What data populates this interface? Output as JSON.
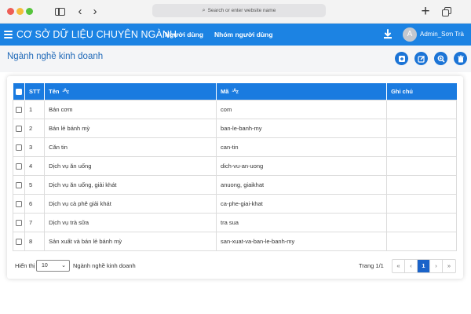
{
  "browser": {
    "address_placeholder": "Search or enter website name"
  },
  "header": {
    "app_title": "CƠ SỞ DỮ LIỆU CHUYÊN NGÀNH",
    "nav": [
      "Người dùng",
      "Nhóm người dùng"
    ],
    "avatar_letter": "A",
    "user_name": "Admin_Sơn Trà"
  },
  "page": {
    "title": "Ngành nghề kinh doanh"
  },
  "table": {
    "columns": [
      "STT",
      "Tên",
      "Mã",
      "Ghi chú"
    ],
    "rows": [
      {
        "stt": "1",
        "ten": "Bán cơm",
        "ma": "com",
        "note": ""
      },
      {
        "stt": "2",
        "ten": "Bán lẻ bánh mỳ",
        "ma": "ban-le-banh-my",
        "note": ""
      },
      {
        "stt": "3",
        "ten": "Căn tin",
        "ma": "can-tin",
        "note": ""
      },
      {
        "stt": "4",
        "ten": "Dịch vụ ăn uống",
        "ma": "dich-vu-an-uong",
        "note": ""
      },
      {
        "stt": "5",
        "ten": "Dịch vụ ăn uống, giải khát",
        "ma": "anuong, giaikhat",
        "note": ""
      },
      {
        "stt": "6",
        "ten": "Dịch vụ cà phê giải khát",
        "ma": "ca-phe-giai-khat",
        "note": ""
      },
      {
        "stt": "7",
        "ten": "Dịch vụ trà sữa",
        "ma": "tra sua",
        "note": ""
      },
      {
        "stt": "8",
        "ten": "Sản xuất và bán lẻ bánh mỳ",
        "ma": "san-xuat-va-ban-le-banh-my",
        "note": ""
      }
    ]
  },
  "footer": {
    "show_label": "Hiển thị",
    "page_size": "10",
    "entity_label": "Ngành nghề kinh doanh",
    "page_info": "Trang 1/1",
    "pager": [
      "«",
      "‹",
      "1",
      "›",
      "»"
    ]
  },
  "colors": {
    "header_blue": "#1c83e3",
    "table_header_blue": "#1a7be0",
    "active_page": "#1a63c9"
  }
}
